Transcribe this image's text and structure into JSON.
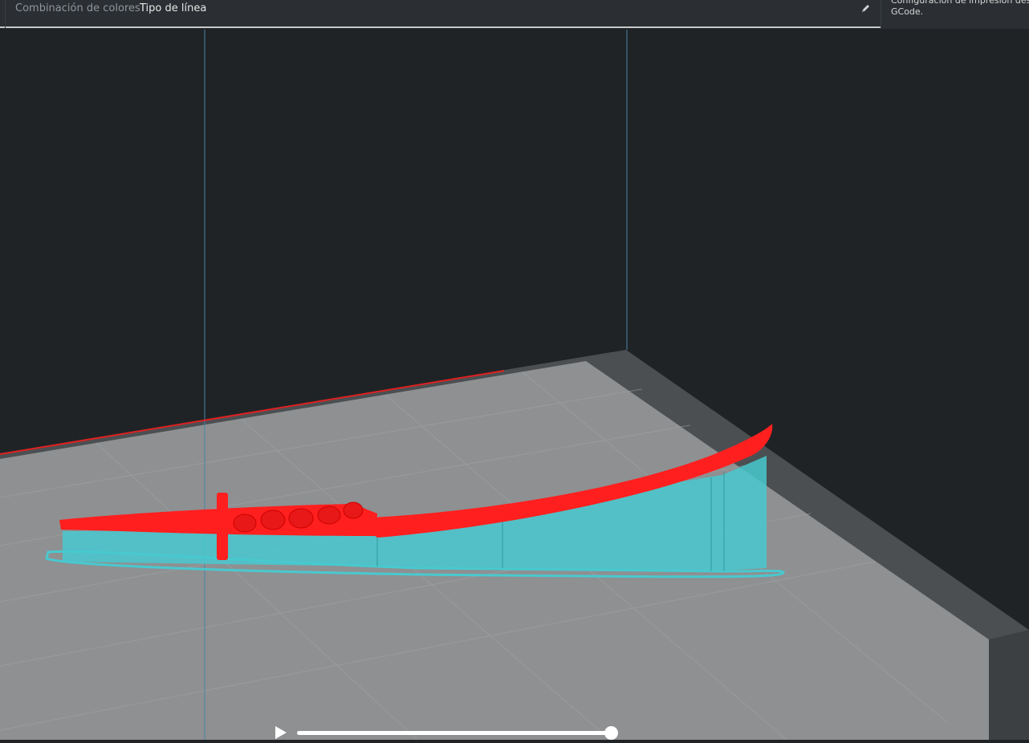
{
  "topbar": {
    "color_scheme_label": "Combinación de colores",
    "color_scheme_value": "Tipo de línea"
  },
  "right_panel": {
    "text": "Configuración de impresión desde\nGCode."
  },
  "icons": {
    "edit": "pencil-icon",
    "play": "play-icon"
  },
  "playback": {
    "progress": 1.0
  },
  "colors": {
    "background": "#1f2326",
    "build_plate": "#8d8f91",
    "model": "#ff1f1f",
    "support": "#48c9cf",
    "accent_line": "#e02020"
  }
}
